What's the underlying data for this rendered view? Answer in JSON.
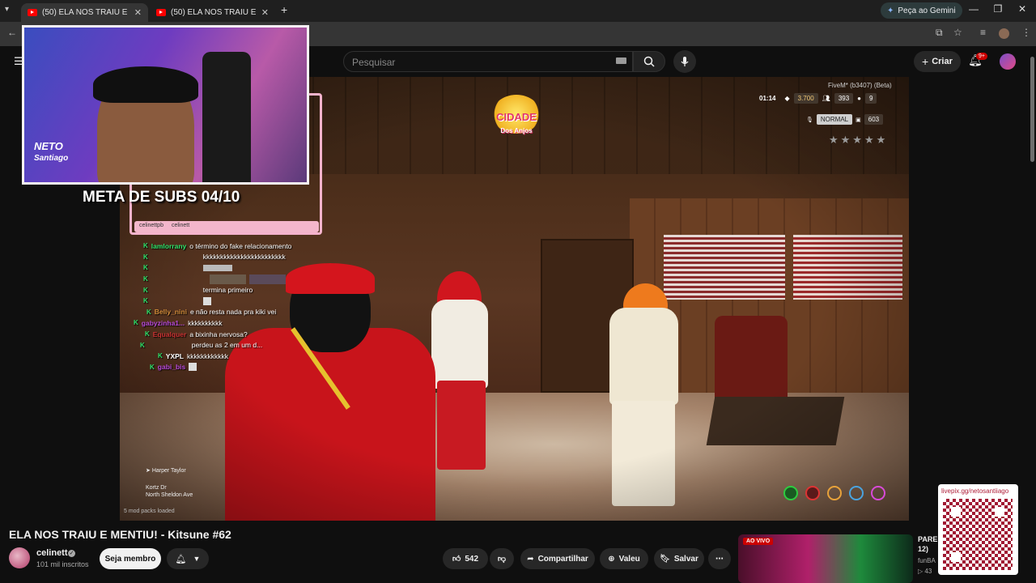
{
  "browser": {
    "tabs": [
      {
        "title": "(50) ELA NOS TRAIU E MENTIU!",
        "active": true
      },
      {
        "title": "(50) ELA NOS TRAIU E MENTIU!",
        "active": false
      }
    ],
    "new_tab_icon": "plus-icon",
    "gemini_label": "Peça ao Gemini"
  },
  "youtube": {
    "search_placeholder": "Pesquisar",
    "create_label": "Criar",
    "notification_badge": "9+"
  },
  "video": {
    "title": "ELA NOS TRAIU E MENTIU! - Kitsune #62",
    "overlay": {
      "meta_subs": "META DE SUBS 04/10",
      "webcam_logo_line1": "NETO",
      "webcam_logo_line2": "Santiago",
      "social_handles": [
        "celinettpb",
        "celinett"
      ],
      "city_logo": "CIDADE",
      "city_logo_sub": "Dos Anjos",
      "hud": {
        "fivem": "FiveM* (b3407) (Beta)",
        "time": "01:14",
        "money": "3.700",
        "players": "393",
        "count": "9",
        "voice_mode": "NORMAL",
        "id": "603",
        "stars": "★★★★★"
      },
      "street_npc": "Harper Taylor",
      "street_name": "Kortz Dr",
      "street_area": "North Sheldon Ave",
      "modpacks": "5 mod packs loaded"
    },
    "chat": [
      {
        "user": "lamlorrany",
        "color": "#2ee36a",
        "text": "o término do fake relacionamento"
      },
      {
        "user": "",
        "color": "#d2691e",
        "text": "kkkkkkkkkkkkkkkkkkkkkkkk"
      },
      {
        "user": "",
        "color": "#d9d9d9",
        "text": ""
      },
      {
        "user": "",
        "color": "#cc3333",
        "text": ""
      },
      {
        "user": "",
        "color": "#cc3333",
        "text": "termina primeiro"
      },
      {
        "user": "",
        "color": "#cc3333",
        "text": ""
      },
      {
        "user": "Belly_nini",
        "color": "#d28c3a",
        "text": "e não resta nada pra kiki vei"
      },
      {
        "user": "gabyzinha1...",
        "color": "#b84ad8",
        "text": "kkkkkkkkkk"
      },
      {
        "user": "Equalquer",
        "color": "#cc3333",
        "text": "a bixinha nervosa?"
      },
      {
        "user": "",
        "color": "#cc3333",
        "text": "perdeu as 2 em um d..."
      },
      {
        "user": "YXPL",
        "color": "#ffffff",
        "text": "kkkkkkkkkkkk"
      },
      {
        "user": "gabi_bis",
        "color": "#b84ad8",
        "text": ""
      }
    ]
  },
  "channel": {
    "name": "celinett",
    "subscribers": "101 mil inscritos",
    "join_label": "Seja membro"
  },
  "actions": {
    "likes": "542",
    "share": "Compartilhar",
    "thanks": "Valeu",
    "save": "Salvar"
  },
  "sidebar": {
    "qr_url": "livepix.gg/netosantiiago",
    "rec_live": "AO VIVO",
    "rec_title_line1": "PARE",
    "rec_title_line2": "12)",
    "rec_channel": "funBA",
    "rec_views": "▷ 43"
  }
}
